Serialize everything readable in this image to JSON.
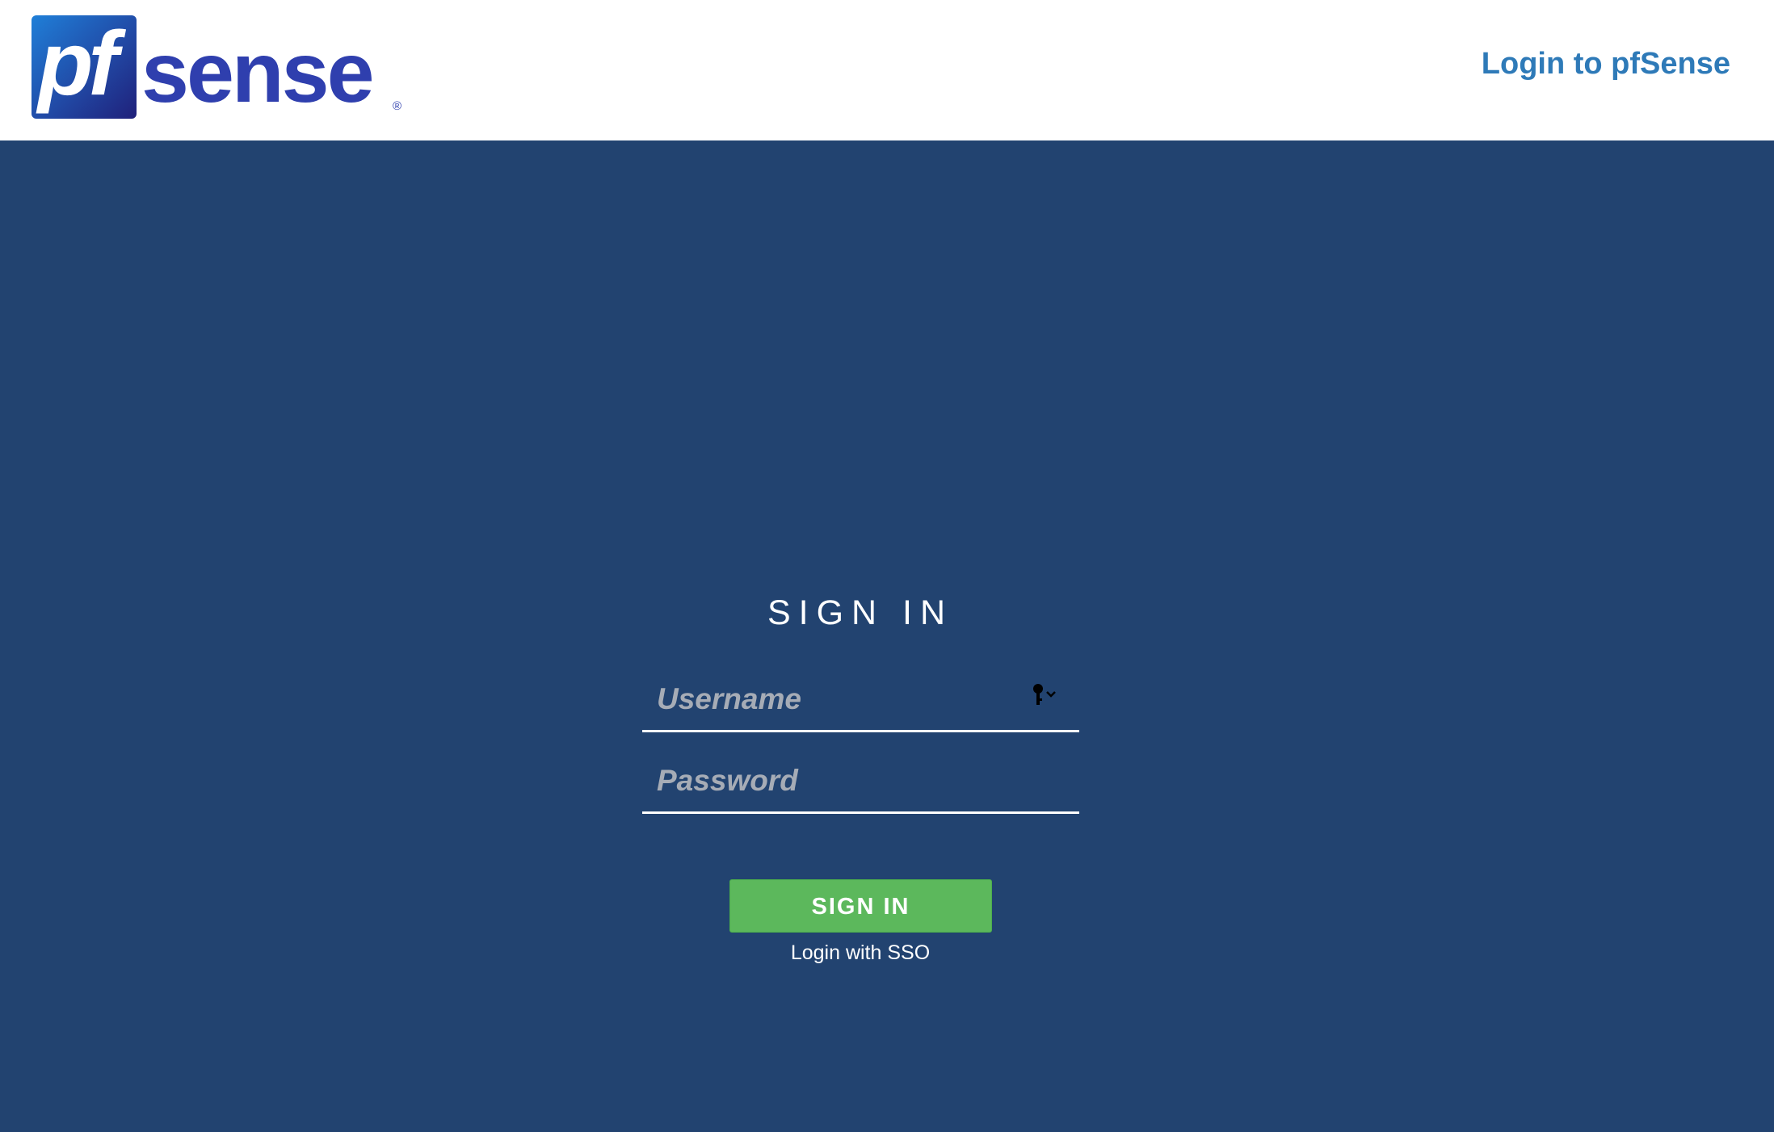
{
  "header": {
    "logo_text": "pfsense",
    "logo_trademark": "®",
    "title": "Login to pfSense"
  },
  "login": {
    "heading": "SIGN IN",
    "username_placeholder": "Username",
    "password_placeholder": "Password",
    "submit_label": "SIGN IN",
    "sso_label": "Login with SSO",
    "key_icon": "key-icon"
  },
  "colors": {
    "background": "#224370",
    "header_background": "#ffffff",
    "header_title": "#2e7ab8",
    "submit_button": "#5cb85c",
    "logo_blue": "#2f3fae",
    "text": "#ffffff"
  }
}
